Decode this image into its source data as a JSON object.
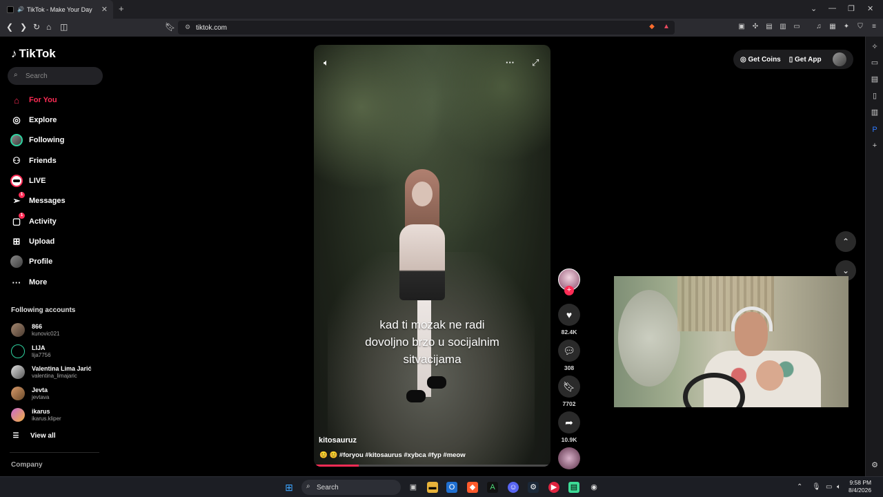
{
  "browser": {
    "tab_title": "TikTok - Make Your Day",
    "new_tab": "+",
    "url": "tiktok.com"
  },
  "sidebar": {
    "logo": "TikTok",
    "search_placeholder": "Search",
    "nav": [
      {
        "label": "For You",
        "icon": "home-icon",
        "active": true
      },
      {
        "label": "Explore",
        "icon": "compass-icon"
      },
      {
        "label": "Following",
        "icon": "avatar-icon"
      },
      {
        "label": "Friends",
        "icon": "friends-icon"
      },
      {
        "label": "LIVE",
        "icon": "live-icon"
      },
      {
        "label": "Messages",
        "icon": "messages-icon",
        "badge": "1"
      },
      {
        "label": "Activity",
        "icon": "activity-icon",
        "badge": "1"
      },
      {
        "label": "Upload",
        "icon": "upload-icon"
      },
      {
        "label": "Profile",
        "icon": "profile-avatar-icon"
      },
      {
        "label": "More",
        "icon": "more-icon"
      }
    ],
    "following_title": "Following accounts",
    "accounts": [
      {
        "name": "866",
        "handle": "kunovic021"
      },
      {
        "name": "LIJA",
        "handle": "lija7756"
      },
      {
        "name": "Valentina Lima Jarić",
        "handle": "valentina_limajaric"
      },
      {
        "name": "Jevta",
        "handle": "jevtava"
      },
      {
        "name": "ikarus",
        "handle": "ikarus.kliper"
      }
    ],
    "view_all": "View all",
    "company": "Company"
  },
  "video": {
    "caption_lines": [
      "kad ti mozak ne radi",
      "dovoljno brzo u socijalnim",
      "sitvacijama"
    ],
    "author": "kitosauruz",
    "tags": "😊 😊 #foryou #kitosaurus #xybca #fyp #meow",
    "progress": 0.19
  },
  "actions": {
    "likes": "82.4K",
    "comments": "308",
    "saves": "7702",
    "shares": "10.9K"
  },
  "topright": {
    "coins": "Get Coins",
    "app": "Get App"
  },
  "taskbar": {
    "search": "Search",
    "time": "9:58 PM",
    "date": "8/4/2026"
  },
  "colors": {
    "accent": "#fe2c55",
    "bg": "#000000"
  }
}
